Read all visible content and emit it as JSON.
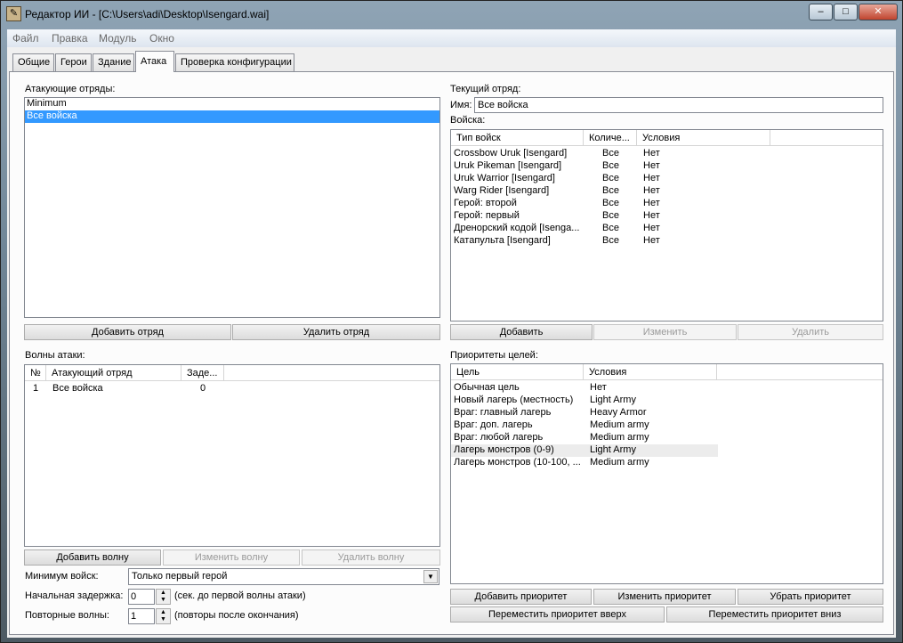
{
  "window": {
    "title": "Редактор ИИ - [C:\\Users\\adi\\Desktop\\Isengard.wai]",
    "minimize": "–",
    "maximize": "□",
    "close": "✕"
  },
  "menu": [
    "Файл",
    "Правка",
    "Модуль",
    "Окно"
  ],
  "tabs": [
    {
      "label": "Общие"
    },
    {
      "label": "Герои"
    },
    {
      "label": "Здание"
    },
    {
      "label": "Атака",
      "active": true
    },
    {
      "label": "Проверка конфигурации"
    }
  ],
  "left": {
    "squads_label": "Атакующие отряды:",
    "squads": [
      "Minimum",
      "Все войска"
    ],
    "selected_squad": 1,
    "add_squad": "Добавить отряд",
    "remove_squad": "Удалить отряд",
    "waves_label": "Волны атаки:",
    "waves_columns": [
      "№",
      "Атакующий отряд",
      "Заде..."
    ],
    "waves": [
      [
        "1",
        "Все войска",
        "0"
      ]
    ],
    "add_wave": "Добавить волну",
    "edit_wave": "Изменить волну",
    "remove_wave": "Удалить волну",
    "min_troops_label": "Минимум войск:",
    "min_troops_value": "Только первый герой",
    "initial_delay_label": "Начальная задержка:",
    "initial_delay_value": "0",
    "initial_delay_hint": "(сек. до первой волны атаки)",
    "repeat_label": "Повторные волны:",
    "repeat_value": "1",
    "repeat_hint": "(повторы после окончания)"
  },
  "right": {
    "current_label": "Текущий отряд:",
    "name_label": "Имя:",
    "name_value": "Все войска",
    "troops_label": "Войска:",
    "troops_columns": [
      "Тип войск",
      "Количе...",
      "Условия"
    ],
    "troops": [
      [
        "Crossbow Uruk [Isengard]",
        "Все",
        "Нет"
      ],
      [
        "Uruk Pikeman [Isengard]",
        "Все",
        "Нет"
      ],
      [
        "Uruk Warrior [Isengard]",
        "Все",
        "Нет"
      ],
      [
        "Warg Rider [Isengard]",
        "Все",
        "Нет"
      ],
      [
        "Герой: второй",
        "Все",
        "Нет"
      ],
      [
        "Герой: первый",
        "Все",
        "Нет"
      ],
      [
        "Дренорский кодой [Isenga...",
        "Все",
        "Нет"
      ],
      [
        "Катапульта [Isengard]",
        "Все",
        "Нет"
      ]
    ],
    "add": "Добавить",
    "edit": "Изменить",
    "remove": "Удалить",
    "priorities_label": "Приоритеты целей:",
    "priorities_columns": [
      "Цель",
      "Условия"
    ],
    "priorities": [
      [
        "Обычная цель",
        "Нет"
      ],
      [
        "Новый лагерь (местность)",
        "Light Army"
      ],
      [
        "Враг: главный лагерь",
        "Heavy Armor"
      ],
      [
        "Враг: доп. лагерь",
        "Medium army"
      ],
      [
        "Враг: любой лагерь",
        "Medium army"
      ],
      [
        "Лагерь монстров (0-9)",
        "Light Army"
      ],
      [
        "Лагерь монстров (10-100, ...",
        "Medium army"
      ]
    ],
    "selected_priority": 5,
    "add_priority": "Добавить приоритет",
    "edit_priority": "Изменить приоритет",
    "remove_priority": "Убрать приоритет",
    "move_up": "Переместить приоритет вверх",
    "move_down": "Переместить приоритет вниз"
  }
}
